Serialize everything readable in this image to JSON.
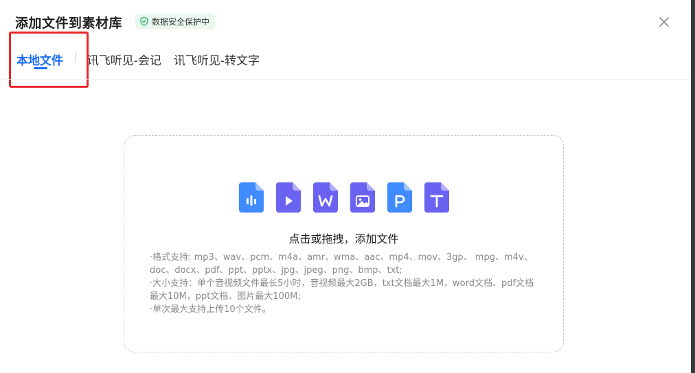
{
  "dialog": {
    "title": "添加文件到素材库",
    "security_badge": "数据安全保护中",
    "close_icon": "close-icon"
  },
  "tabs": [
    {
      "label": "本地文件",
      "active": true
    },
    {
      "label": "讯飞听见-会记",
      "active": false
    },
    {
      "label": "讯飞听见-转文字",
      "active": false
    }
  ],
  "tab_separator": "|",
  "upload": {
    "file_type_icons": [
      "audio-file-icon",
      "video-file-icon",
      "word-file-icon",
      "image-file-icon",
      "ppt-file-icon",
      "text-file-icon"
    ],
    "title": "点击或拖拽，添加文件",
    "info_lines": [
      "·格式支持: mp3、wav、pcm、m4a、amr、wma、aac、mp4、mov、3gp、 mpg、m4v、doc、docx、pdf、ppt、pptx、jpg、jpeg、png、bmp、txt;",
      "·大小支持：单个音视频文件最长5小时，音视频最大2GB，txt文档最大1M，word文档、pdf文档最大10M，ppt文档、图片最大100M;",
      "·单次最大支持上传10个文件。"
    ]
  },
  "colors": {
    "accent": "#1a6ef5",
    "highlight": "#e8262b",
    "badge_bg": "#e9f7ee",
    "badge_icon": "#2fb56a",
    "icon_blue": "#3f8bff",
    "icon_purple": "#6a63f2"
  }
}
